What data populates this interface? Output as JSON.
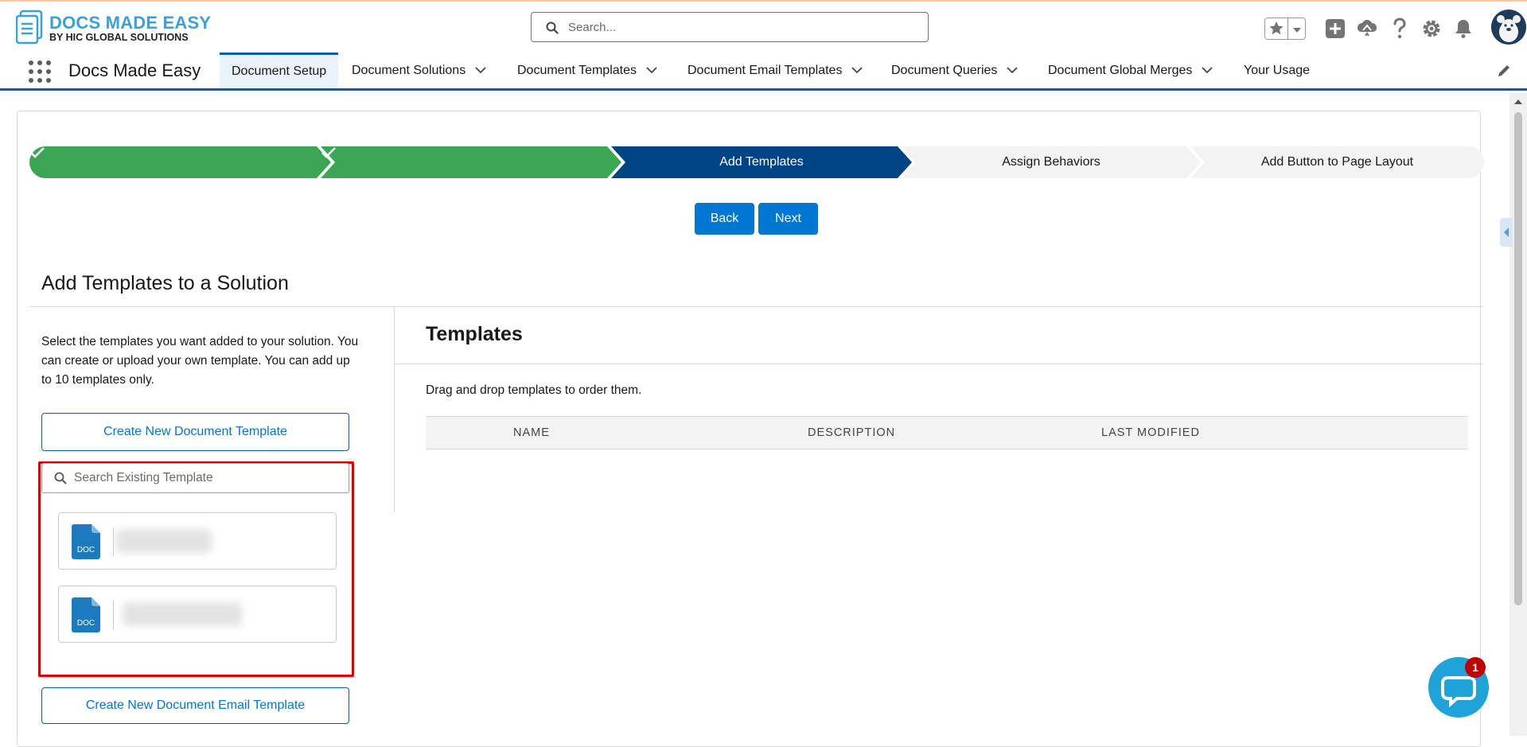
{
  "logo": {
    "title": "DOCS MADE EASY",
    "subtitle": "BY HIC GLOBAL SOLUTIONS"
  },
  "header": {
    "search_placeholder": "Search...",
    "icons": [
      "favorites-star-icon",
      "add-icon",
      "trailhead-icon",
      "help-icon",
      "setup-gear-icon",
      "notifications-bell-icon",
      "user-avatar"
    ]
  },
  "nav": {
    "app_name": "Docs Made Easy",
    "tabs": [
      {
        "label": "Document Setup",
        "active": true,
        "dropdown": false
      },
      {
        "label": "Document Solutions",
        "active": false,
        "dropdown": true
      },
      {
        "label": "Document Templates",
        "active": false,
        "dropdown": true
      },
      {
        "label": "Document Email Templates",
        "active": false,
        "dropdown": true
      },
      {
        "label": "Document Queries",
        "active": false,
        "dropdown": true
      },
      {
        "label": "Document Global Merges",
        "active": false,
        "dropdown": true
      },
      {
        "label": "Your Usage",
        "active": false,
        "dropdown": false
      }
    ]
  },
  "path": {
    "steps": [
      {
        "label": "",
        "status": "complete"
      },
      {
        "label": "",
        "status": "complete"
      },
      {
        "label": "Add Templates",
        "status": "current"
      },
      {
        "label": "Assign Behaviors",
        "status": "incomplete"
      },
      {
        "label": "Add Button to Page Layout",
        "status": "incomplete"
      }
    ]
  },
  "actions": {
    "back_label": "Back",
    "next_label": "Next"
  },
  "section": {
    "title": "Add Templates to a Solution",
    "description": "Select the templates you want added to your solution. You can create or upload your own template. You can add up to 10 templates only.",
    "create_template_label": "Create New Document Template",
    "template_search_placeholder": "Search Existing Template",
    "existing_templates": [
      {
        "icon_label": "DOC",
        "name_hidden": true
      },
      {
        "icon_label": "DOC",
        "name_hidden": true
      }
    ],
    "create_email_template_label": "Create New Document Email Template"
  },
  "templates_panel": {
    "title": "Templates",
    "hint": "Drag and drop templates to order them.",
    "columns": [
      "NAME",
      "DESCRIPTION",
      "LAST MODIFIED"
    ]
  },
  "chat": {
    "badge_count": "1"
  },
  "colors": {
    "brand_blue": "#0176d3",
    "complete_green": "#3ba755",
    "current_navy": "#014486",
    "incomplete_gray": "#f3f3f3",
    "highlight_red": "#e00000"
  }
}
